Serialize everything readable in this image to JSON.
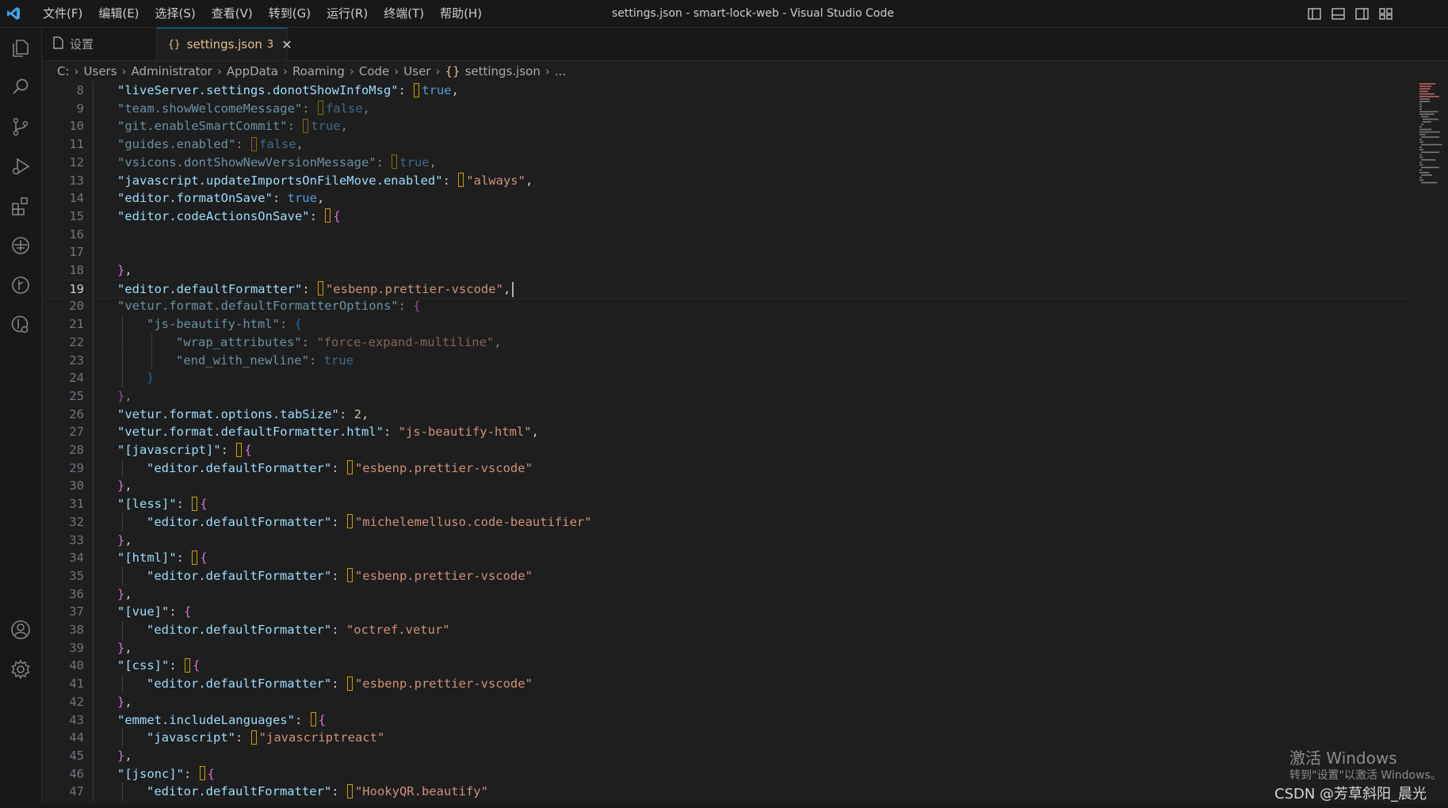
{
  "titlebar": {
    "menu": [
      "文件(F)",
      "编辑(E)",
      "选择(S)",
      "查看(V)",
      "转到(G)",
      "运行(R)",
      "终端(T)",
      "帮助(H)"
    ],
    "title": "settings.json - smart-lock-web - Visual Studio Code"
  },
  "tabs": [
    {
      "label": "设置",
      "icon": "file-icon"
    },
    {
      "label": "settings.json",
      "icon": "json-braces-icon",
      "badge": "3"
    }
  ],
  "breadcrumb": [
    "C:",
    "Users",
    "Administrator",
    "AppData",
    "Roaming",
    "Code",
    "User",
    "settings.json",
    "..."
  ],
  "editor": {
    "current_line": 19,
    "lines": [
      {
        "n": "8",
        "text": "\"liveServer.settings.donotShowInfoMsg\": true,"
      },
      {
        "n": "9",
        "text": "\"team.showWelcomeMessage\": false,"
      },
      {
        "n": "10",
        "text": "\"git.enableSmartCommit\": true,"
      },
      {
        "n": "11",
        "text": "\"guides.enabled\": false,"
      },
      {
        "n": "12",
        "text": "\"vsicons.dontShowNewVersionMessage\": true,"
      },
      {
        "n": "13",
        "text": "\"javascript.updateImportsOnFileMove.enabled\": \"always\","
      },
      {
        "n": "14",
        "text": "\"editor.formatOnSave\": true,"
      },
      {
        "n": "15",
        "text": "\"editor.codeActionsOnSave\": {"
      },
      {
        "n": "16",
        "text": ""
      },
      {
        "n": "17",
        "text": ""
      },
      {
        "n": "18",
        "text": "},"
      },
      {
        "n": "19",
        "text": "\"editor.defaultFormatter\": \"esbenp.prettier-vscode\","
      },
      {
        "n": "20",
        "text": "\"vetur.format.defaultFormatterOptions\": {"
      },
      {
        "n": "21",
        "text": "\"js-beautify-html\": {"
      },
      {
        "n": "22",
        "text": "\"wrap_attributes\": \"force-expand-multiline\","
      },
      {
        "n": "23",
        "text": "\"end_with_newline\": true"
      },
      {
        "n": "24",
        "text": "}"
      },
      {
        "n": "25",
        "text": "},"
      },
      {
        "n": "26",
        "text": "\"vetur.format.options.tabSize\": 2,"
      },
      {
        "n": "27",
        "text": "\"vetur.format.defaultFormatter.html\": \"js-beautify-html\","
      },
      {
        "n": "28",
        "text": "\"[javascript]\": {"
      },
      {
        "n": "29",
        "text": "\"editor.defaultFormatter\": \"esbenp.prettier-vscode\""
      },
      {
        "n": "30",
        "text": "},"
      },
      {
        "n": "31",
        "text": "\"[less]\": {"
      },
      {
        "n": "32",
        "text": "\"editor.defaultFormatter\": \"michelemelluso.code-beautifier\""
      },
      {
        "n": "33",
        "text": "},"
      },
      {
        "n": "34",
        "text": "\"[html]\": {"
      },
      {
        "n": "35",
        "text": "\"editor.defaultFormatter\": \"esbenp.prettier-vscode\""
      },
      {
        "n": "36",
        "text": "},"
      },
      {
        "n": "37",
        "text": "\"[vue]\": {"
      },
      {
        "n": "38",
        "text": "\"editor.defaultFormatter\": \"octref.vetur\""
      },
      {
        "n": "39",
        "text": "},"
      },
      {
        "n": "40",
        "text": "\"[css]\": {"
      },
      {
        "n": "41",
        "text": "\"editor.defaultFormatter\": \"esbenp.prettier-vscode\""
      },
      {
        "n": "42",
        "text": "},"
      },
      {
        "n": "43",
        "text": "\"emmet.includeLanguages\": {"
      },
      {
        "n": "44",
        "text": "\"javascript\": \"javascriptreact\""
      },
      {
        "n": "45",
        "text": "},"
      },
      {
        "n": "46",
        "text": "\"[jsonc]\": {"
      },
      {
        "n": "47",
        "text": "\"editor.defaultFormatter\": \"HookyQR.beautify\""
      }
    ]
  },
  "watermark": {
    "line1": "激活 Windows",
    "line2": "转到\"设置\"以激活 Windows。"
  },
  "csdn": "CSDN @芳草斜阳_晨光",
  "colors": {
    "accent": "#0078d4",
    "tab_modified": "#e2c08d"
  }
}
